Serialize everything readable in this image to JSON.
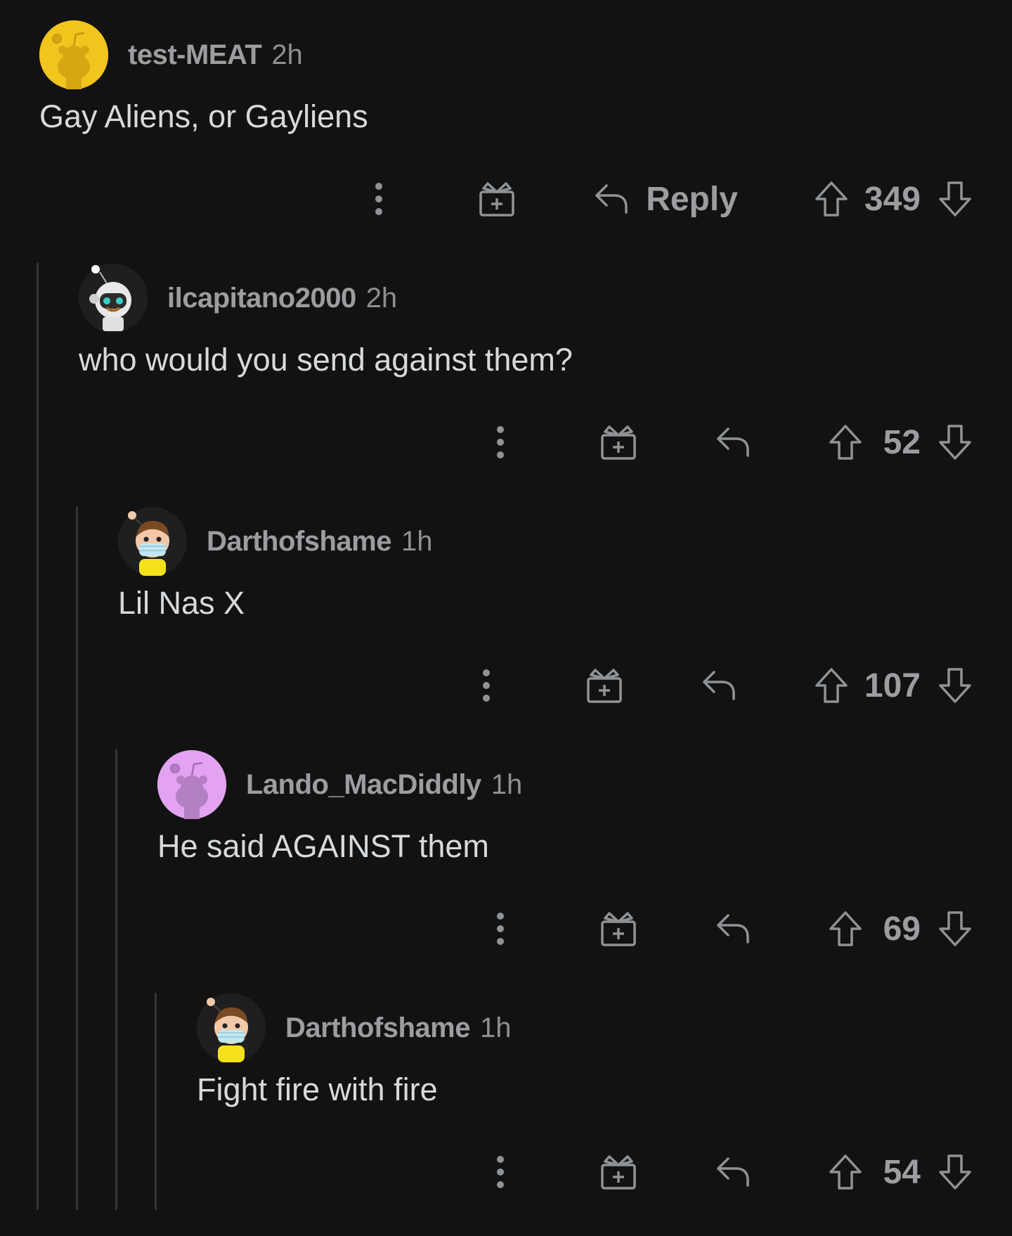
{
  "comments": [
    {
      "username": "test-MEAT",
      "age": "2h",
      "body": "Gay Aliens, or Gayliens",
      "score": "349",
      "reply_label": "Reply",
      "avatar": {
        "style": "snoo",
        "bg": "#f2c41e"
      }
    },
    {
      "username": "ilcapitano2000",
      "age": "2h",
      "body": "who would you send against them?",
      "score": "52",
      "avatar": {
        "style": "astronaut-snoo",
        "bg": "#1a1a1b"
      }
    },
    {
      "username": "Darthofshame",
      "age": "1h",
      "body": "Lil Nas X",
      "score": "107",
      "avatar": {
        "style": "masked-snoo",
        "bg": "#1a1a1b"
      }
    },
    {
      "username": "Lando_MacDiddly",
      "age": "1h",
      "body": "He said AGAINST them",
      "score": "69",
      "avatar": {
        "style": "snoo",
        "bg": "#e3a2f2"
      }
    },
    {
      "username": "Darthofshame",
      "age": "1h",
      "body": "Fight fire with fire",
      "score": "54",
      "avatar": {
        "style": "masked-snoo",
        "bg": "#1a1a1b"
      }
    }
  ],
  "icons": {
    "more": "vertical-dots-icon",
    "award": "gift-icon",
    "reply": "reply-arrow-icon",
    "upvote": "upvote-arrow-icon",
    "downvote": "downvote-arrow-icon"
  }
}
